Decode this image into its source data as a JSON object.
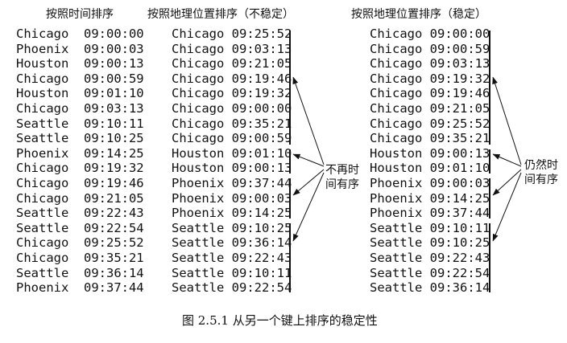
{
  "headers": {
    "col1": "按照时间排序",
    "col2": "按照地理位置排序（不稳定）",
    "col3": "按照地理位置排序（稳定）"
  },
  "columns": {
    "by_time": [
      "Chicago  09:00:00",
      "Phoenix  09:00:03",
      "Houston  09:00:13",
      "Chicago  09:00:59",
      "Houston  09:01:10",
      "Chicago  09:03:13",
      "Seattle  09:10:11",
      "Seattle  09:10:25",
      "Phoenix  09:14:25",
      "Chicago  09:19:32",
      "Chicago  09:19:46",
      "Chicago  09:21:05",
      "Seattle  09:22:43",
      "Seattle  09:22:54",
      "Chicago  09:25:52",
      "Chicago  09:35:21",
      "Seattle  09:36:14",
      "Phoenix  09:37:44"
    ],
    "unstable": [
      "Chicago 09:25:52",
      "Chicago 09:03:13",
      "Chicago 09:21:05",
      "Chicago 09:19:46",
      "Chicago 09:19:32",
      "Chicago 09:00:00",
      "Chicago 09:35:21",
      "Chicago 09:00:59",
      "Houston 09:01:10",
      "Houston 09:00:13",
      "Phoenix 09:37:44",
      "Phoenix 09:00:03",
      "Phoenix 09:14:25",
      "Seattle 09:10:25",
      "Seattle 09:36:14",
      "Seattle 09:22:43",
      "Seattle 09:10:11",
      "Seattle 09:22:54"
    ],
    "stable": [
      "Chicago 09:00:00",
      "Chicago 09:00:59",
      "Chicago 09:03:13",
      "Chicago 09:19:32",
      "Chicago 09:19:46",
      "Chicago 09:21:05",
      "Chicago 09:25:52",
      "Chicago 09:35:21",
      "Houston 09:00:13",
      "Houston 09:01:10",
      "Phoenix 09:00:03",
      "Phoenix 09:14:25",
      "Phoenix 09:37:44",
      "Seattle 09:10:11",
      "Seattle 09:10:25",
      "Seattle 09:22:43",
      "Seattle 09:22:54",
      "Seattle 09:36:14"
    ]
  },
  "notes": {
    "unstable_line1": "不再时",
    "unstable_line2": "间有序",
    "stable_line1": "仍然时",
    "stable_line2": "间有序"
  },
  "caption": "图 2.5.1    从另一个键上排序的稳定性"
}
